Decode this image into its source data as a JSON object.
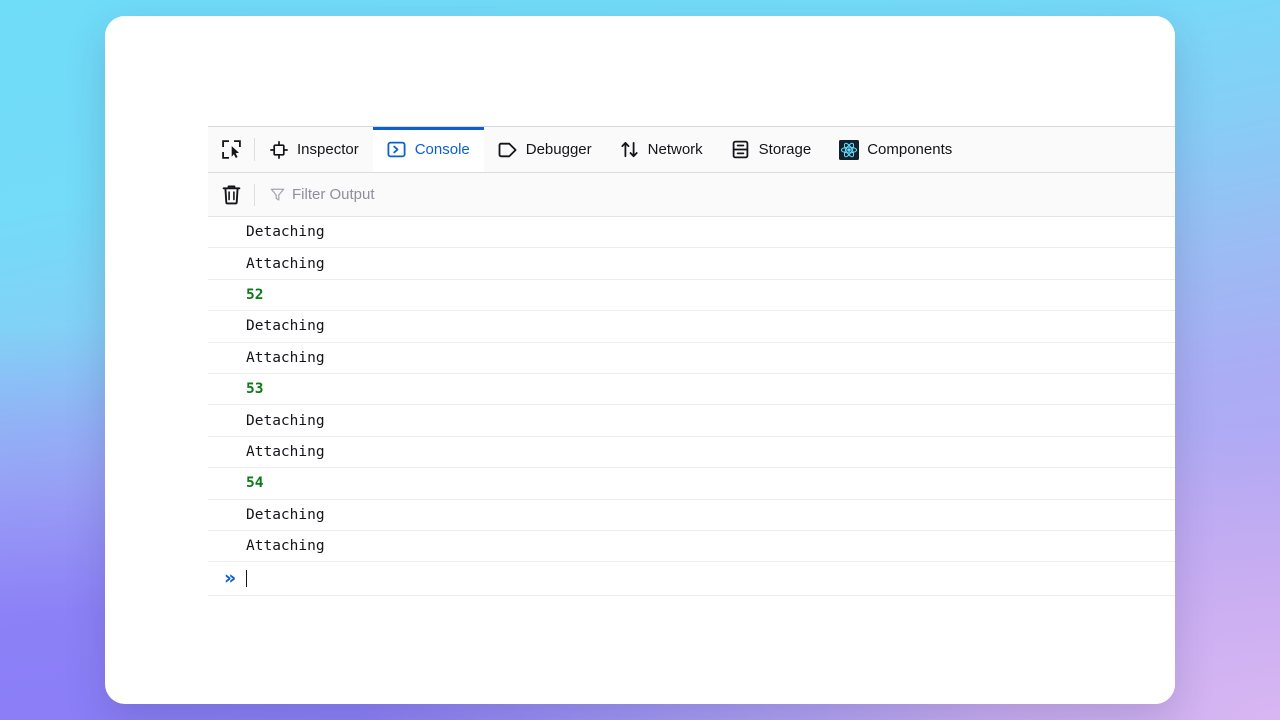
{
  "window": {
    "title": "Browser Window"
  },
  "devtools": {
    "picker": {
      "icon": "element-picker-icon",
      "label": "Pick an element from the page"
    },
    "tabs": [
      {
        "id": "inspector",
        "label": "Inspector",
        "icon": "inspector-icon",
        "active": false
      },
      {
        "id": "console",
        "label": "Console",
        "icon": "console-icon",
        "active": true
      },
      {
        "id": "debugger",
        "label": "Debugger",
        "icon": "debugger-icon",
        "active": false
      },
      {
        "id": "network",
        "label": "Network",
        "icon": "network-icon",
        "active": false
      },
      {
        "id": "storage",
        "label": "Storage",
        "icon": "storage-icon",
        "active": false
      },
      {
        "id": "components",
        "label": "Components",
        "icon": "react-logo-icon",
        "active": false
      }
    ],
    "filter_bar": {
      "clear_label": "Clear console",
      "clear_icon": "trash-icon",
      "filter_icon": "funnel-icon",
      "filter_placeholder": "Filter Output",
      "filter_value": ""
    },
    "console": {
      "messages": [
        {
          "text": "Detaching",
          "type": "string"
        },
        {
          "text": "Attaching",
          "type": "string"
        },
        {
          "text": "52",
          "type": "number"
        },
        {
          "text": "Detaching",
          "type": "string"
        },
        {
          "text": "Attaching",
          "type": "string"
        },
        {
          "text": "53",
          "type": "number"
        },
        {
          "text": "Detaching",
          "type": "string"
        },
        {
          "text": "Attaching",
          "type": "string"
        },
        {
          "text": "54",
          "type": "number"
        },
        {
          "text": "Detaching",
          "type": "string"
        },
        {
          "text": "Attaching",
          "type": "string"
        }
      ],
      "prompt": {
        "chevron": "»",
        "value": "",
        "placeholder": ""
      }
    }
  },
  "colors": {
    "accent_blue": "#0a60cf",
    "number_green": "#0b7a17",
    "toolbar_bg": "#fafafb",
    "text": "#15141a",
    "placeholder": "#8f8f9d"
  }
}
